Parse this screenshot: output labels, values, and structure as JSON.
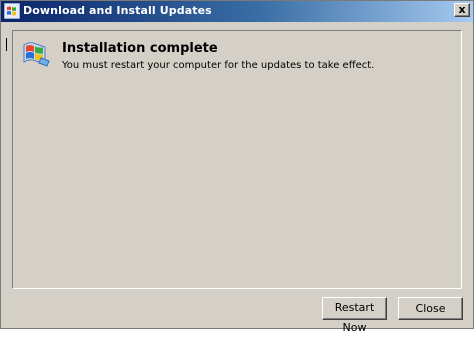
{
  "window": {
    "title": "Download and Install Updates",
    "close_glyph": "x"
  },
  "content": {
    "heading": "Installation complete",
    "message": "You must restart your computer for the updates to take effect."
  },
  "buttons": {
    "restart_label": "Restart Now",
    "close_label": "Close"
  },
  "icons": {
    "title": "windows-update-icon",
    "content": "windows-update-icon"
  },
  "colors": {
    "titlebar_start": "#0a246a",
    "titlebar_end": "#a6caf0",
    "face": "#d4d0c8"
  }
}
